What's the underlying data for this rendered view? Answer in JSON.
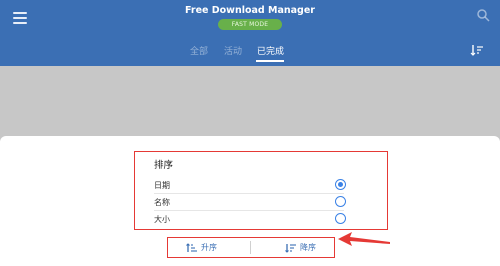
{
  "header": {
    "title": "Free Download Manager",
    "mode_badge": "FAST MODE",
    "tabs": [
      {
        "label": "全部",
        "active": false
      },
      {
        "label": "活动",
        "active": false
      },
      {
        "label": "已完成",
        "active": true
      }
    ],
    "icons": {
      "menu": "menu-icon",
      "search": "search-icon",
      "sort": "sort-icon"
    }
  },
  "sort_sheet": {
    "title": "排序",
    "options": [
      {
        "label": "日期",
        "selected": true
      },
      {
        "label": "名称",
        "selected": false
      },
      {
        "label": "大小",
        "selected": false
      }
    ],
    "ascending_label": "升序",
    "descending_label": "降序"
  },
  "colors": {
    "header_bg": "#3b6fb4",
    "badge_bg": "#68b04a",
    "accent": "#3b82e6",
    "highlight": "#e53935"
  }
}
